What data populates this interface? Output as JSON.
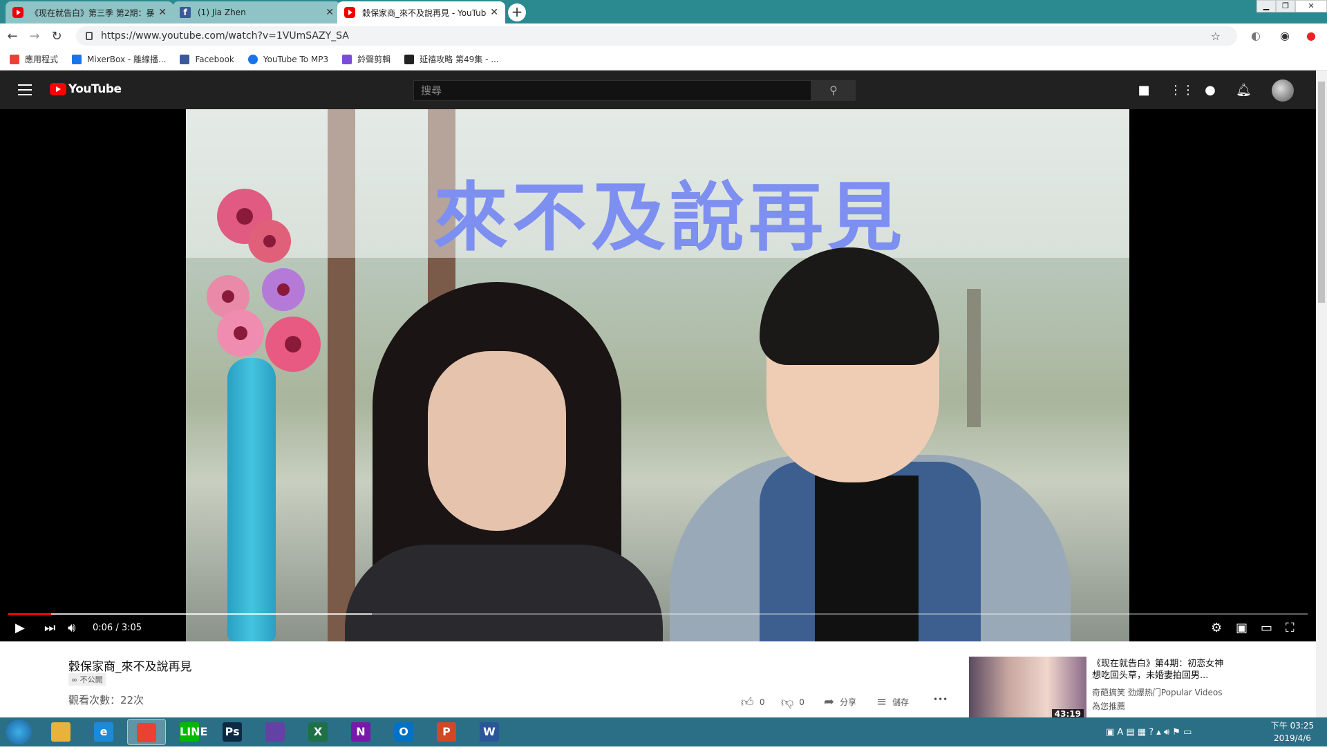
{
  "browser": {
    "tabs": [
      {
        "title": "《现在就告白》第三季 第2期：暴",
        "icon": "youtube-icon",
        "active": false
      },
      {
        "title": "(1) Jia Zhen",
        "icon": "facebook-icon",
        "active": false
      },
      {
        "title": "穀保家商_來不及說再見 - YouTube",
        "icon": "youtube-icon",
        "active": true
      }
    ],
    "new_tab": "+",
    "close_glyph": "✕",
    "url": "https://www.youtube.com/watch?v=1VUmSAZY_SA",
    "bookmarks": [
      {
        "label": "應用程式",
        "icon": "apps-grid-icon",
        "color": "#e94235"
      },
      {
        "label": "MixerBox - 離線播...",
        "icon": "mixerbox-icon",
        "color": "#1a73e8"
      },
      {
        "label": "Facebook",
        "icon": "facebook-icon",
        "color": "#3b5998"
      },
      {
        "label": "YouTube To MP3",
        "icon": "ytmp3-icon",
        "color": "#1a73e8"
      },
      {
        "label": "鈴聲剪輯",
        "icon": "ringtone-icon",
        "color": "#7b4bd9"
      },
      {
        "label": "延禧攻略 第49集 - ...",
        "icon": "video-site-icon",
        "color": "#222222"
      }
    ]
  },
  "youtube": {
    "logo_text": "YouTube",
    "search_placeholder": "搜尋",
    "video_overlay_title": "來不及說再見",
    "player": {
      "time": "0:06 / 3:05",
      "played_fraction": 0.033,
      "loaded_fraction": 0.28
    },
    "video": {
      "title": "穀保家商_來不及說再見",
      "visibility": "不公開",
      "views": "觀看次數：22次",
      "likes": "0",
      "dislikes": "0",
      "share_label": "分享",
      "save_label": "儲存",
      "more_glyph": "•••"
    },
    "recommendation": {
      "title": "《现在就告白》第4期：初恋女神想吃回头草，未婚妻拍回男...",
      "channel": "奇葩搞笑 劲爆热门Popular Videos",
      "tag": "為您推薦",
      "duration": "43:19"
    }
  },
  "taskbar": {
    "apps": [
      {
        "name": "explorer",
        "label": "",
        "color": "#e8b33a"
      },
      {
        "name": "ie",
        "label": "e",
        "color": "#1d8ad9"
      },
      {
        "name": "chrome",
        "label": "",
        "color": "#e94235"
      },
      {
        "name": "line",
        "label": "LINE",
        "color": "#00b900"
      },
      {
        "name": "photoshop",
        "label": "Ps",
        "color": "#0d2a45"
      },
      {
        "name": "twitch",
        "label": "",
        "color": "#6441a5"
      },
      {
        "name": "excel",
        "label": "X",
        "color": "#1e7145"
      },
      {
        "name": "onenote",
        "label": "N",
        "color": "#7719aa"
      },
      {
        "name": "outlook",
        "label": "O",
        "color": "#0072c6"
      },
      {
        "name": "powerpoint",
        "label": "P",
        "color": "#d24726"
      },
      {
        "name": "word",
        "label": "W",
        "color": "#2b579a"
      }
    ],
    "clock_time": "下午 03:25",
    "clock_date": "2019/4/6"
  }
}
